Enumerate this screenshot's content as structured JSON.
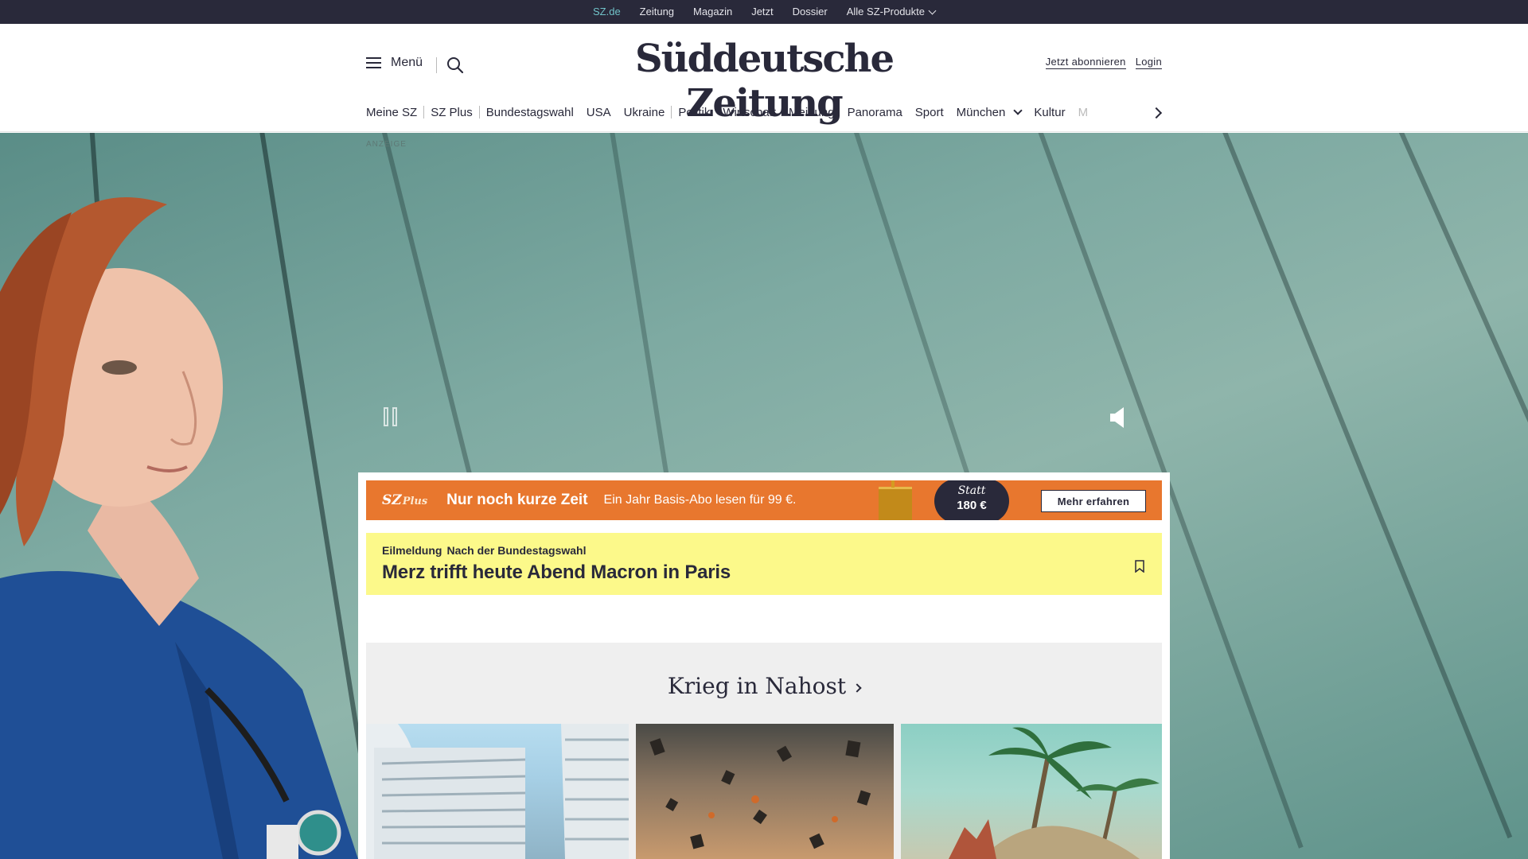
{
  "topbar": {
    "links": [
      "SZ.de",
      "Zeitung",
      "Magazin",
      "Jetzt",
      "Dossier"
    ],
    "products_label": "Alle SZ-Produkte"
  },
  "header": {
    "menu_label": "Menü",
    "logo": "Süddeutsche Zeitung",
    "subscribe_label": "Jetzt abonnieren",
    "login_label": "Login"
  },
  "nav": {
    "items": [
      "Meine SZ",
      "SZ Plus",
      "Bundestagswahl",
      "USA",
      "Ukraine",
      "Politik",
      "Wirtschaft",
      "Meinung",
      "Panorama",
      "Sport",
      "München",
      "Kultur",
      "M"
    ]
  },
  "ad": {
    "label": "ANZEIGE"
  },
  "promo": {
    "brand": "SZ",
    "brand_plus": "Plus",
    "headline": "Nur noch kurze Zeit",
    "subline": "Ein Jahr Basis-Abo lesen für 99 €.",
    "badge_statt": "Statt",
    "badge_price": "180 €",
    "cta_label": "Mehr erfahren"
  },
  "breaking": {
    "kicker": "Eilmeldung",
    "topic": "Nach der Bundestagswahl",
    "title": "Merz trifft heute Abend Macron in Paris"
  },
  "section": {
    "title": "Krieg in Nahost"
  },
  "colors": {
    "topbar_bg": "#29293a",
    "active_link": "#71c3c9",
    "promo_bg": "#e8772e",
    "breaking_bg": "#fcf98a",
    "section_bg": "#efefef"
  }
}
